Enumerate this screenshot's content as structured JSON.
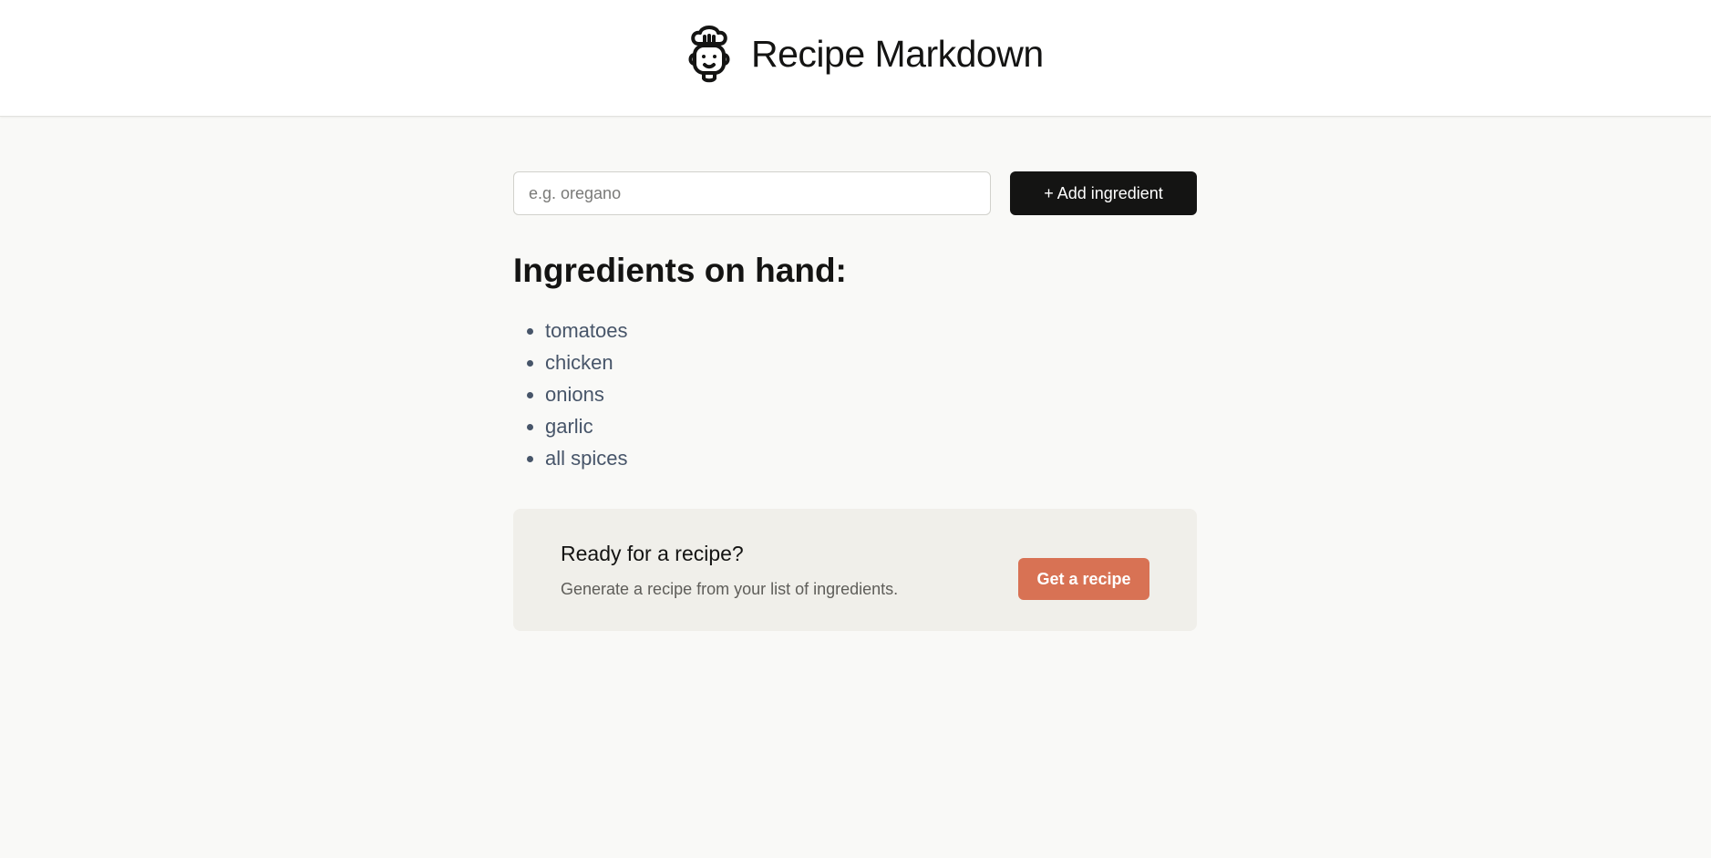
{
  "header": {
    "title": "Recipe Markdown",
    "logo_icon": "chef-icon"
  },
  "add_form": {
    "input_value": "",
    "input_placeholder": "e.g. oregano",
    "button_label": "+ Add ingredient"
  },
  "ingredients": {
    "title": "Ingredients on hand:",
    "items": [
      "tomatoes",
      "chicken",
      "onions",
      "garlic",
      "all spices"
    ]
  },
  "cta": {
    "title": "Ready for a recipe?",
    "subtitle": "Generate a recipe from your list of ingredients.",
    "button_label": "Get a recipe"
  },
  "colors": {
    "background": "#f9f9f7",
    "primary_button": "#141413",
    "accent": "#d87254",
    "cta_panel": "#f0efea",
    "list_text": "#475569"
  }
}
